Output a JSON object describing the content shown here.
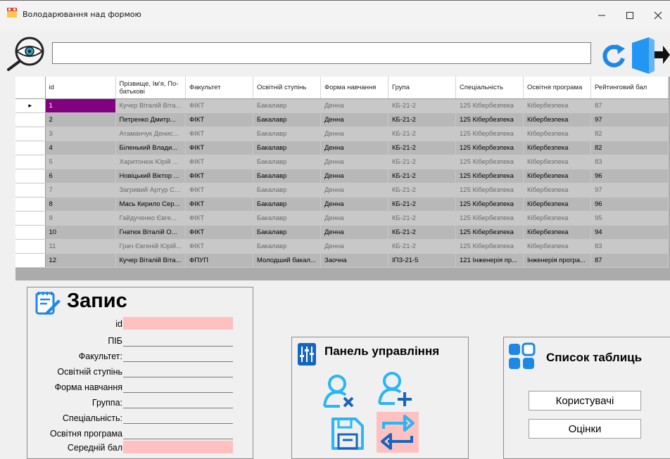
{
  "window": {
    "title": "Володарювання над формою",
    "minimize_icon": "minimize-icon",
    "maximize_icon": "maximize-icon",
    "close_icon": "close-icon"
  },
  "toolbar": {
    "search_icon": "eye-magnifier-icon",
    "search_value": "",
    "refresh_icon": "refresh-icon",
    "exit_icon": "exit-door-icon"
  },
  "grid": {
    "columns": [
      "id",
      "Прізвище, Ім'я, По-батькові",
      "Факультет",
      "Освітній ступінь",
      "Форма навчання",
      "Група",
      "Спеціальність",
      "Освітня програма",
      "Рейтинговий бал"
    ],
    "current_row_marker": "▸",
    "rows": [
      [
        "1",
        "Кучер Віталій Віта...",
        "ФІКТ",
        "Бакалавр",
        "Денна",
        "КБ-21-2",
        "125 Кібербезпека",
        "Кібербезпека",
        "87"
      ],
      [
        "2",
        "Петренко Дмитр...",
        "ФІКТ",
        "Бакалавр",
        "Денна",
        "КБ-21-2",
        "125 Кібербезпека",
        "Кібербезпека",
        "97"
      ],
      [
        "3",
        "Атаманчук Денис...",
        "ФІКТ",
        "Бакалавр",
        "Денна",
        "КБ-21-2",
        "125 Кібербезпека",
        "Кібербезпека",
        "82"
      ],
      [
        "4",
        "Біленький Влади...",
        "ФІКТ",
        "Бакалавр",
        "Денна",
        "КБ-21-2",
        "125 Кібербезпека",
        "Кібербезпека",
        "82"
      ],
      [
        "5",
        "Харитонюк Юрій ...",
        "ФІКТ",
        "Бакалавр",
        "Денна",
        "КБ-21-2",
        "125 Кібербезпека",
        "Кібербезпека",
        "83"
      ],
      [
        "6",
        "Новіцький Віктор ...",
        "ФІКТ",
        "Бакалавр",
        "Денна",
        "КБ-21-2",
        "125 Кібербезпека",
        "Кібербезпека",
        "96"
      ],
      [
        "7",
        "Загривий Артур С...",
        "ФІКТ",
        "Бакалавр",
        "Денна",
        "КБ-21-2",
        "125 Кібербезпека",
        "Кібербезпека",
        "97"
      ],
      [
        "8",
        "Мась Кирило Сер...",
        "ФІКТ",
        "Бакалавр",
        "Денна",
        "КБ-21-2",
        "125 Кібербезпека",
        "Кібербезпека",
        "96"
      ],
      [
        "9",
        "Гайдученко Євге...",
        "ФІКТ",
        "Бакалавр",
        "Денна",
        "КБ-21-2",
        "125 Кібербезпека",
        "Кібербезпека",
        "95"
      ],
      [
        "10",
        "Гнатюк Віталій О...",
        "ФІКТ",
        "Бакалавр",
        "Денна",
        "КБ-21-2",
        "125 Кібербезпека",
        "Кібербезпека",
        "94"
      ],
      [
        "11",
        "Грач Євгеній Юрій...",
        "ФІКТ",
        "Бакалавр",
        "Денна",
        "КБ-21-2",
        "125 Кібербезпека",
        "Кібербезпека",
        "83"
      ],
      [
        "12",
        "Кучер Віталій Віта...",
        "ФПУП",
        "Молодший бакал...",
        "Заочна",
        "ІПЗ-21-5",
        "121 Інженерія пр...",
        "Інженерія програ...",
        "87"
      ]
    ]
  },
  "record": {
    "title": "Запис",
    "icon": "edit-document-icon",
    "fields": [
      {
        "label": "id",
        "value": ""
      },
      {
        "label": "ПІБ",
        "value": ""
      },
      {
        "label": "Факультет:",
        "value": ""
      },
      {
        "label": "Освітній ступінь",
        "value": ""
      },
      {
        "label": "Форма навчання",
        "value": ""
      },
      {
        "label": "Группа:",
        "value": ""
      },
      {
        "label": "Спеціальність:",
        "value": ""
      },
      {
        "label": "Освітня програма",
        "value": ""
      },
      {
        "label": "Середній бал",
        "value": ""
      }
    ]
  },
  "control_panel": {
    "title": "Панель управління",
    "icon": "sliders-icon",
    "buttons": [
      "delete-user-icon",
      "add-user-icon",
      "save-icon",
      "sync-icon"
    ]
  },
  "tables_list": {
    "title": "Список таблиць",
    "icon": "grid-squares-icon",
    "users_label": "Користувачі",
    "grades_label": "Оцінки"
  },
  "colors": {
    "selected_id": "#800080",
    "highlight_field": "#ffc0c0",
    "icon_cyan": "#29b6f6",
    "icon_blue": "#1565c0"
  }
}
